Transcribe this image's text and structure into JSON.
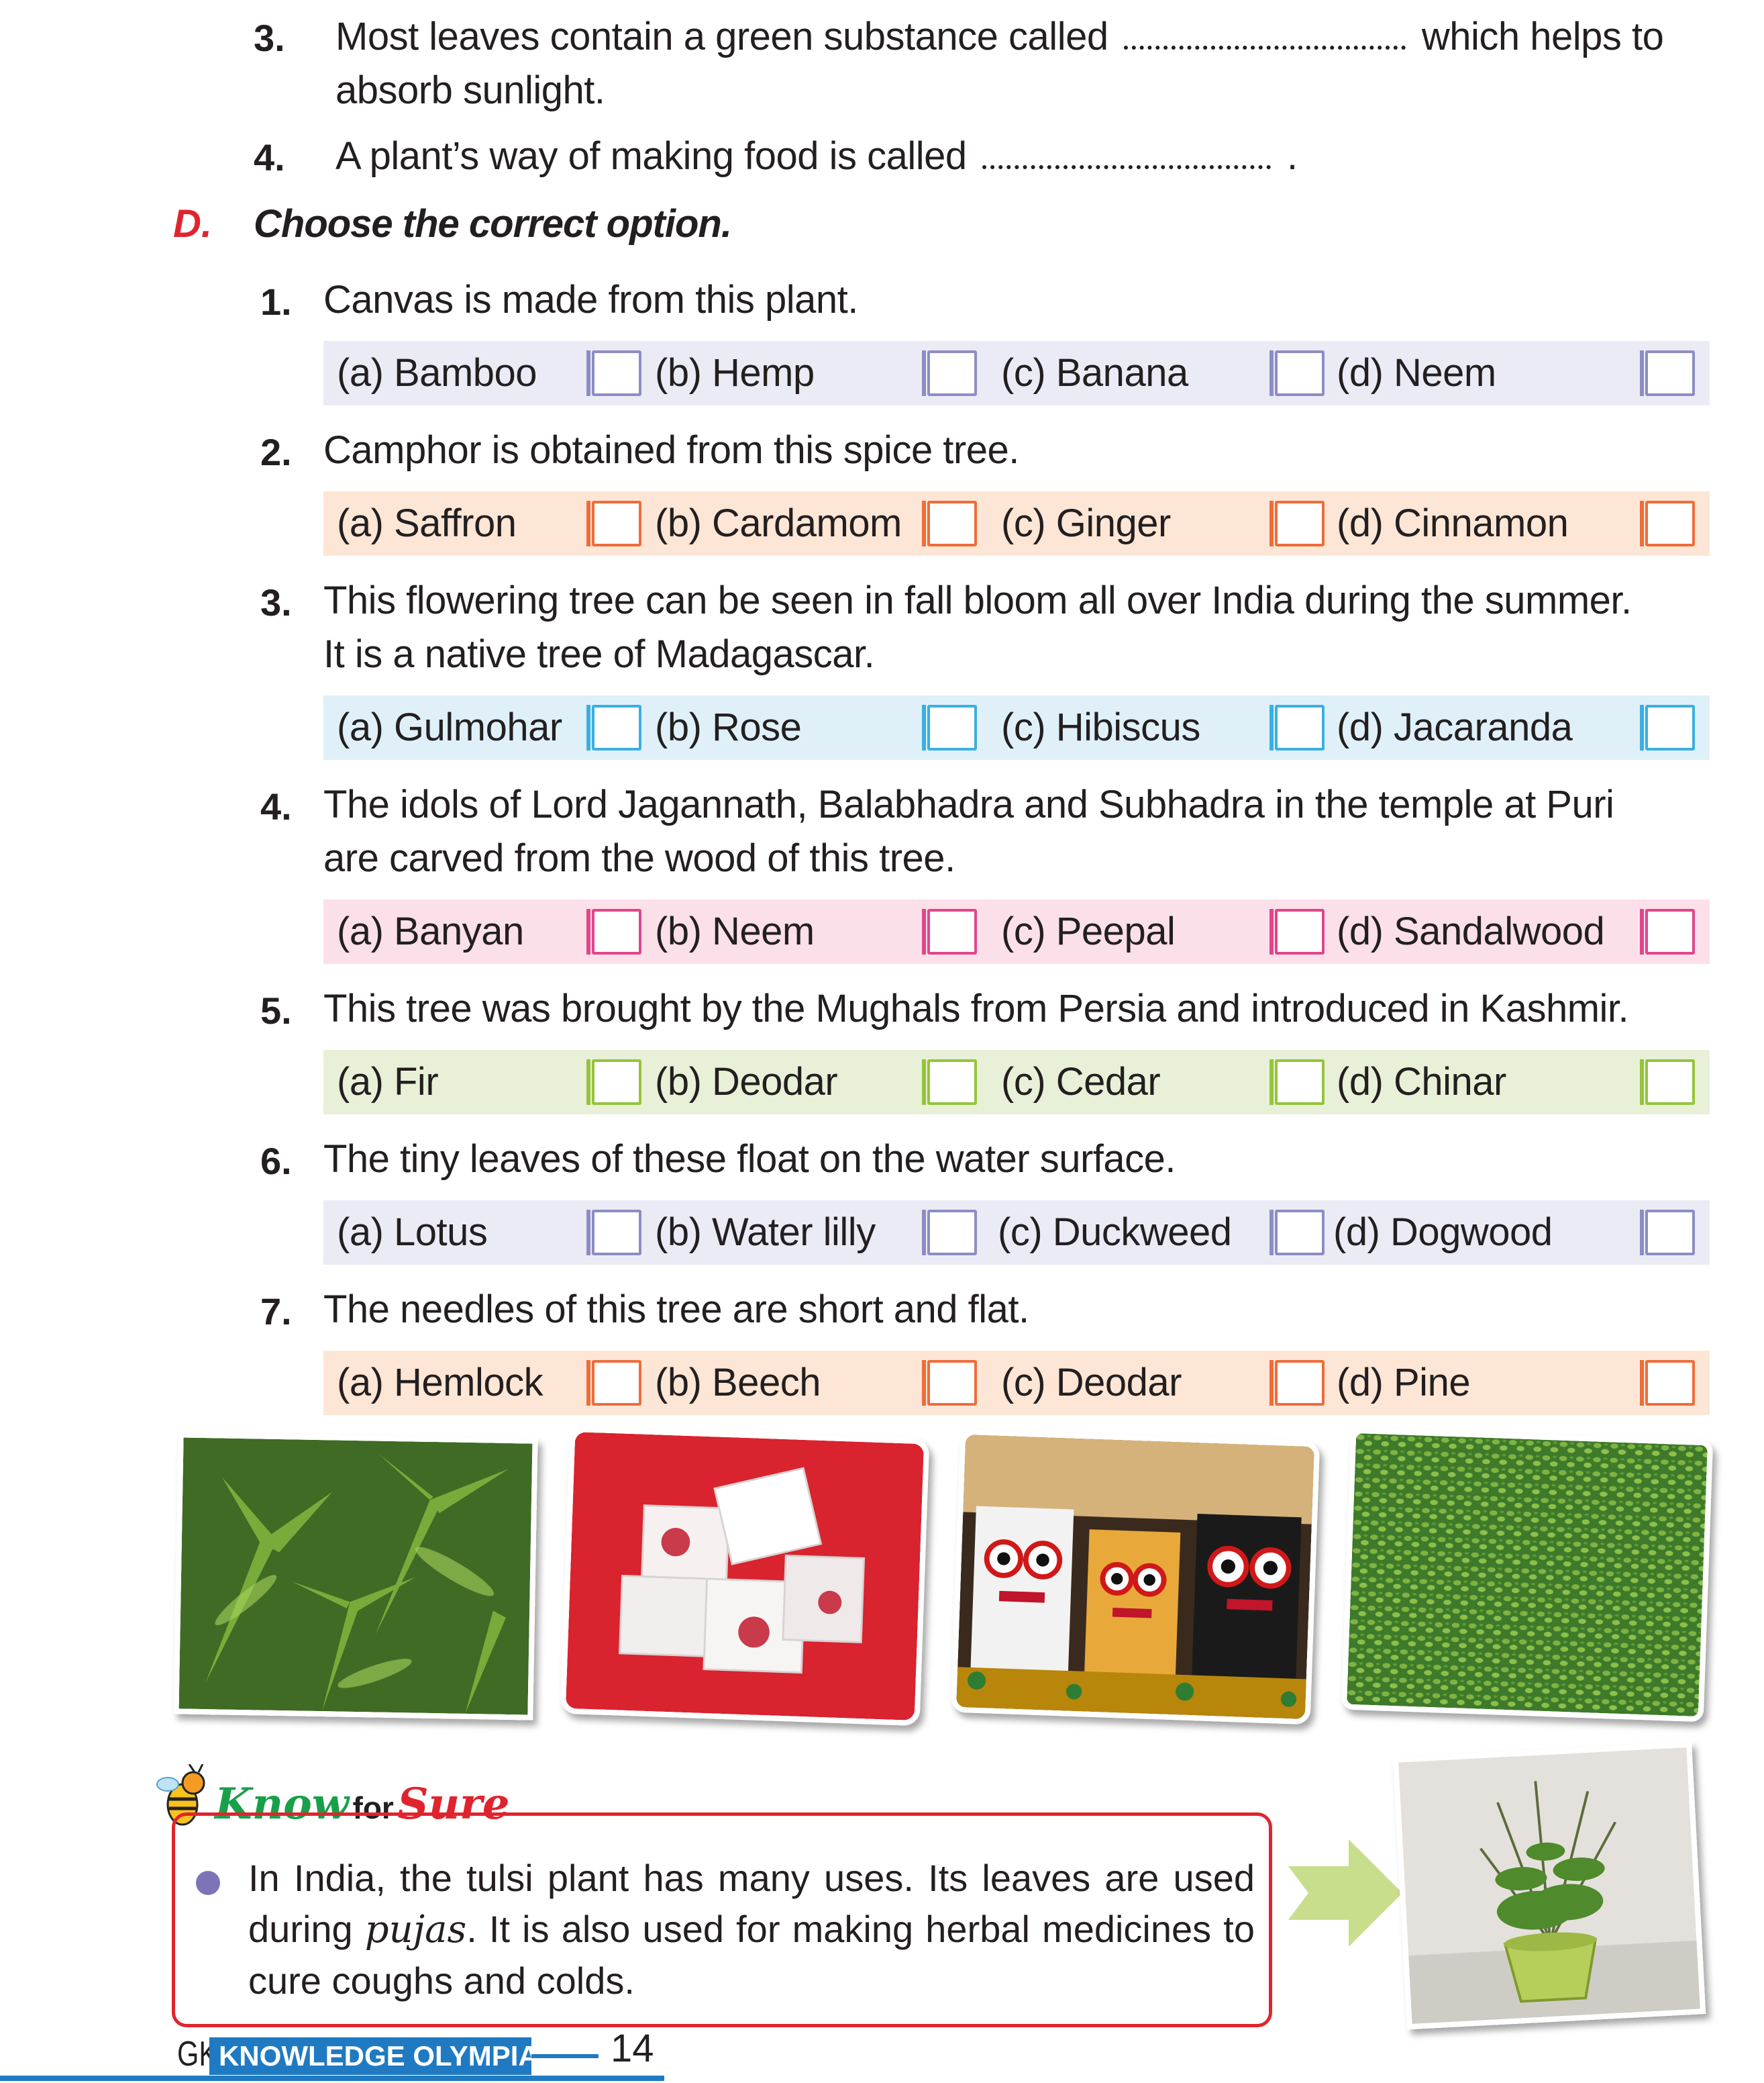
{
  "fill_blanks": [
    {
      "number": "3.",
      "before": "Most leaves contain a green substance called",
      "after": "which helps to",
      "line2": "absorb sunlight."
    },
    {
      "number": "4.",
      "before": "A plant’s way of making food is called",
      "after": "."
    }
  ],
  "section": {
    "letter": "D.",
    "title": "Choose the correct option."
  },
  "questions": [
    {
      "number": "1.",
      "lines": [
        "Canvas is made from this plant."
      ],
      "options": [
        "(a) Bamboo",
        "(b) Hemp",
        "(c) Banana",
        "(d) Neem"
      ]
    },
    {
      "number": "2.",
      "lines": [
        "Camphor is obtained from this spice tree."
      ],
      "options": [
        "(a) Saffron",
        "(b) Cardamom",
        "(c) Ginger",
        "(d) Cinnamon"
      ]
    },
    {
      "number": "3.",
      "lines": [
        "This flowering tree can be seen in fall bloom all over India during the summer.",
        "It is a native tree of Madagascar."
      ],
      "options": [
        "(a) Gulmohar",
        "(b) Rose",
        "(c) Hibiscus",
        "(d) Jacaranda"
      ]
    },
    {
      "number": "4.",
      "lines": [
        "The idols of Lord Jagannath, Balabhadra and Subhadra in the temple at Puri",
        "are carved from the wood of this tree."
      ],
      "options": [
        "(a) Banyan",
        "(b) Neem",
        "(c) Peepal",
        "(d) Sandalwood"
      ]
    },
    {
      "number": "5.",
      "lines": [
        "This tree was brought by the Mughals from Persia and introduced in Kashmir."
      ],
      "options": [
        "(a) Fir",
        "(b) Deodar",
        "(c) Cedar",
        "(d) Chinar"
      ]
    },
    {
      "number": "6.",
      "lines": [
        "The tiny leaves of these float on the water surface."
      ],
      "options": [
        "(a) Lotus",
        "(b) Water lilly",
        "(c) Duckweed",
        "(d) Dogwood"
      ]
    },
    {
      "number": "7.",
      "lines": [
        "The needles of this tree are short and flat."
      ],
      "options": [
        "(a) Hemlock",
        "(b) Beech",
        "(c) Deodar",
        "(d) Pine"
      ]
    }
  ],
  "photos": [
    "hemp-leaves-photo",
    "camphor-cubes-photo",
    "jagannath-idols-photo",
    "duckweed-photo",
    "tulsi-plant-photo"
  ],
  "know_for_sure": {
    "title_know": "Know",
    "title_for": "for",
    "title_sure": "Sure",
    "text_a": "In India, the tulsi plant has many uses. Its leaves are used during ",
    "text_italic": "pujas",
    "text_b": ". It is also used for making herbal medicines to cure coughs and colds."
  },
  "footer": {
    "gk": "GK",
    "band": "KNOWLEDGE OLYMPIAD",
    "page": "14"
  },
  "colors": {
    "section_red": "#e0242e",
    "footer_blue": "#1f7ac2",
    "bullet": "#7c74b6",
    "arrow": "#c8de8c"
  }
}
